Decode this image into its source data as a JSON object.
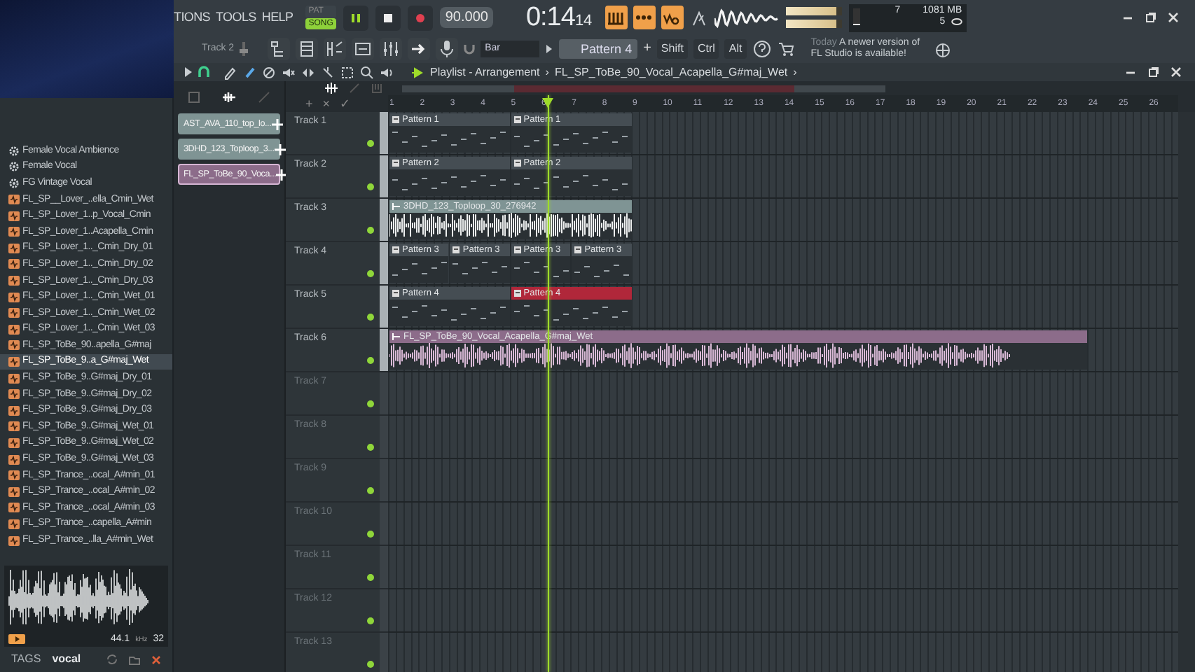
{
  "menu": [
    {
      "label": "TIONS"
    },
    {
      "label": "TOOLS"
    },
    {
      "label": "HELP"
    }
  ],
  "transport": {
    "pat_label": "PAT",
    "song_label": "SONG",
    "song_mode": true,
    "playing": true,
    "tempo": "90.000",
    "time_main": "0:14",
    "time_sub": "14"
  },
  "mode_buttons": [
    {
      "kind": "typing",
      "on": true
    },
    {
      "kind": "countdown",
      "on": true
    },
    {
      "kind": "wait",
      "on": true
    }
  ],
  "master_meter": {
    "level": 0.92
  },
  "cpu": {
    "value": "7",
    "memory": "1081 MB",
    "polyphony": "5",
    "level": 0.08
  },
  "toolbar": {
    "track": "Track 2",
    "snap": "Bar",
    "pattern": "Pattern 4",
    "plus": "+",
    "keys": [
      {
        "label": "Shift"
      },
      {
        "label": "Ctrl"
      },
      {
        "label": "Alt"
      }
    ]
  },
  "hint": {
    "prefix": "Today",
    "message": "A newer version of FL Studio is available!"
  },
  "browser": {
    "items": [
      {
        "name": "Female Vocal Ambience",
        "kind": "preset",
        "selected": false
      },
      {
        "name": "Female Vocal",
        "kind": "preset",
        "selected": false
      },
      {
        "name": "FG Vintage Vocal",
        "kind": "preset",
        "selected": false
      },
      {
        "name": "FL_SP__Lover_..ella_Cmin_Wet",
        "kind": "audio",
        "selected": false
      },
      {
        "name": "FL_SP_Lover_1..p_Vocal_Cmin",
        "kind": "audio",
        "selected": false
      },
      {
        "name": "FL_SP_Lover_1..Acapella_Cmin",
        "kind": "audio",
        "selected": false
      },
      {
        "name": "FL_SP_Lover_1.._Cmin_Dry_01",
        "kind": "audio",
        "selected": false
      },
      {
        "name": "FL_SP_Lover_1.._Cmin_Dry_02",
        "kind": "audio",
        "selected": false
      },
      {
        "name": "FL_SP_Lover_1.._Cmin_Dry_03",
        "kind": "audio",
        "selected": false
      },
      {
        "name": "FL_SP_Lover_1.._Cmin_Wet_01",
        "kind": "audio",
        "selected": false
      },
      {
        "name": "FL_SP_Lover_1.._Cmin_Wet_02",
        "kind": "audio",
        "selected": false
      },
      {
        "name": "FL_SP_Lover_1.._Cmin_Wet_03",
        "kind": "audio",
        "selected": false
      },
      {
        "name": "FL_SP_ToBe_90..apella_G#maj",
        "kind": "audio",
        "selected": false
      },
      {
        "name": "FL_SP_ToBe_9..a_G#maj_Wet",
        "kind": "audio",
        "selected": true
      },
      {
        "name": "FL_SP_ToBe_9..G#maj_Dry_01",
        "kind": "audio",
        "selected": false
      },
      {
        "name": "FL_SP_ToBe_9..G#maj_Dry_02",
        "kind": "audio",
        "selected": false
      },
      {
        "name": "FL_SP_ToBe_9..G#maj_Dry_03",
        "kind": "audio",
        "selected": false
      },
      {
        "name": "FL_SP_ToBe_9..G#maj_Wet_01",
        "kind": "audio",
        "selected": false
      },
      {
        "name": "FL_SP_ToBe_9..G#maj_Wet_02",
        "kind": "audio",
        "selected": false
      },
      {
        "name": "FL_SP_ToBe_9..G#maj_Wet_03",
        "kind": "audio",
        "selected": false
      },
      {
        "name": "FL_SP_Trance_..ocal_A#min_01",
        "kind": "audio",
        "selected": false
      },
      {
        "name": "FL_SP_Trance_..ocal_A#min_02",
        "kind": "audio",
        "selected": false
      },
      {
        "name": "FL_SP_Trance_..ocal_A#min_03",
        "kind": "audio",
        "selected": false
      },
      {
        "name": "FL_SP_Trance_..capella_A#min",
        "kind": "audio",
        "selected": false
      },
      {
        "name": "FL_SP_Trance_..lla_A#min_Wet",
        "kind": "audio",
        "selected": false
      }
    ],
    "preview": {
      "rate": "44.1",
      "unit": "kHz",
      "bits": "32"
    },
    "tags": {
      "label": "TAGS",
      "value": "vocal"
    }
  },
  "playlist": {
    "title": "Playlist - Arrangement",
    "separator": "›",
    "clip_name": "FL_SP_ToBe_90_Vocal_Acapella_G#maj_Wet",
    "end_mark": "›",
    "picker": [
      {
        "name": "AST_AVA_110_top_lo...",
        "color": "#7f9494",
        "selected": false
      },
      {
        "name": "3DHD_123_Toploop_3...",
        "color": "#7f9494",
        "selected": false
      },
      {
        "name": "FL_SP_ToBe_90_Voca...",
        "color": "#8c6c8a",
        "selected": true
      }
    ],
    "lane_tools": [
      {
        "label": "+"
      },
      {
        "label": "×"
      },
      {
        "label": "✓"
      }
    ],
    "ruler": [
      "1",
      "2",
      "3",
      "4",
      "5",
      "6",
      "7",
      "8",
      "9",
      "10",
      "11",
      "12",
      "13",
      "14",
      "15",
      "16",
      "17",
      "18",
      "19",
      "20",
      "21",
      "22",
      "23",
      "24",
      "25",
      "26"
    ],
    "playhead": {
      "level": 0.202
    },
    "tracks": [
      {
        "name": "Track 1",
        "clips": [
          {
            "kind": "pattern",
            "name": "Pattern 1",
            "selected": false
          },
          {
            "kind": "pattern",
            "name": "Pattern 1",
            "selected": false
          }
        ]
      },
      {
        "name": "Track 2",
        "clips": [
          {
            "kind": "pattern",
            "name": "Pattern 2",
            "selected": false
          },
          {
            "kind": "pattern",
            "name": "Pattern 2",
            "selected": false
          }
        ]
      },
      {
        "name": "Track 3",
        "clips": [
          {
            "kind": "loop",
            "name": "3DHD_123_Toploop_30_276942",
            "color": "#7f9494"
          }
        ]
      },
      {
        "name": "Track 4",
        "clips": [
          {
            "kind": "pattern",
            "name": "Pattern 3",
            "selected": false
          },
          {
            "kind": "pattern",
            "name": "Pattern 3",
            "selected": false
          },
          {
            "kind": "pattern",
            "name": "Pattern 3",
            "selected": false
          },
          {
            "kind": "pattern",
            "name": "Pattern 3",
            "selected": false
          }
        ]
      },
      {
        "name": "Track 5",
        "clips": [
          {
            "kind": "pattern",
            "name": "Pattern 4",
            "selected": false
          },
          {
            "kind": "pattern",
            "name": "Pattern 4",
            "selected": true
          }
        ]
      },
      {
        "name": "Track 6",
        "clips": [
          {
            "kind": "vocal",
            "name": "FL_SP_ToBe_90_Vocal_Acapella_G#maj_Wet",
            "color": "#8c6c8a"
          }
        ]
      },
      {
        "name": "Track 7"
      },
      {
        "name": "Track 8"
      },
      {
        "name": "Track 9"
      },
      {
        "name": "Track 10"
      },
      {
        "name": "Track 11"
      },
      {
        "name": "Track 12"
      },
      {
        "name": "Track 13"
      }
    ]
  }
}
